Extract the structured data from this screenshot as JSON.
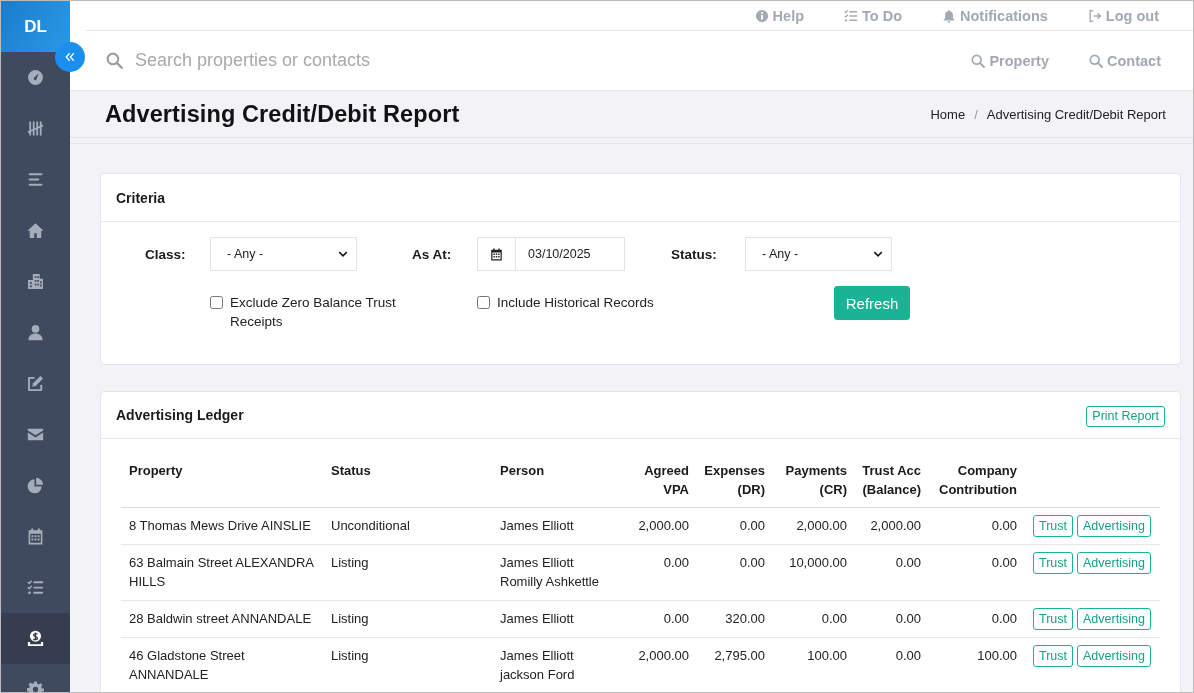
{
  "sidebar": {
    "logo": "DL",
    "items": [
      {
        "selected": false
      },
      {
        "selected": false
      },
      {
        "selected": false
      },
      {
        "selected": false
      },
      {
        "selected": false
      },
      {
        "selected": false
      },
      {
        "selected": false
      },
      {
        "selected": false
      },
      {
        "selected": false
      },
      {
        "selected": false
      },
      {
        "selected": false
      },
      {
        "selected": true
      },
      {
        "selected": false
      }
    ]
  },
  "top_links": [
    "Help",
    "To Do",
    "Notifications",
    "Log out"
  ],
  "search": {
    "placeholder": "Search properties or contacts",
    "links": [
      "Property",
      "Contact"
    ]
  },
  "page_heading": {
    "title": "Advertising Credit/Debit Report",
    "breadcrumb": [
      "Home",
      "Advertising Credit/Debit Report"
    ],
    "breadcrumb_separator": "/"
  },
  "criteria": {
    "title": "Criteria",
    "fields": [
      {
        "kind": "select",
        "label": "Class:",
        "value": "- Any -"
      },
      {
        "kind": "date",
        "label": "As At:",
        "value": "03/10/2025"
      },
      {
        "kind": "select",
        "label": "Status:",
        "value": "- Any -"
      }
    ],
    "checkboxes": [
      {
        "label": "Exclude Zero Balance Trust Receipts",
        "checked": false
      },
      {
        "label": "Include Historical Records",
        "checked": false
      }
    ],
    "button": "Refresh"
  },
  "ledger": {
    "title": "Advertising Ledger",
    "print_button": "Print Report",
    "table": {
      "columns": [
        "Property",
        "Status",
        "Person",
        "Agreed VPA",
        "Expenses (DR)",
        "Payments (CR)",
        "Trust Acc (Balance)",
        "Company Contribution"
      ],
      "rows": [
        {
          "property": "8 Thomas Mews Drive AINSLIE",
          "status": "Unconditional",
          "people": [
            "James Elliott"
          ],
          "agreed_vpa": "2,000.00",
          "expenses": "0.00",
          "payments": "2,000.00",
          "trust_balance": "2,000.00",
          "company_contribution": "0.00",
          "actions": [
            "Trust",
            "Advertising"
          ]
        },
        {
          "property": "63 Balmain Street ALEXANDRA HILLS",
          "status": "Listing",
          "people": [
            "James Elliott",
            "Romilly Ashkettle"
          ],
          "agreed_vpa": "0.00",
          "expenses": "0.00",
          "payments": "10,000.00",
          "trust_balance": "0.00",
          "company_contribution": "0.00",
          "actions": [
            "Trust",
            "Advertising"
          ]
        },
        {
          "property": "28 Baldwin street ANNANDALE",
          "status": "Listing",
          "people": [
            "James Elliott"
          ],
          "agreed_vpa": "0.00",
          "expenses": "320.00",
          "payments": "0.00",
          "trust_balance": "0.00",
          "company_contribution": "0.00",
          "actions": [
            "Trust",
            "Advertising"
          ]
        },
        {
          "property": "46 Gladstone Street ANNANDALE",
          "status": "Listing",
          "people": [
            "James Elliott",
            "jackson Ford"
          ],
          "agreed_vpa": "2,000.00",
          "expenses": "2,795.00",
          "payments": "100.00",
          "trust_balance": "0.00",
          "company_contribution": "100.00",
          "actions": [
            "Trust",
            "Advertising"
          ]
        }
      ]
    }
  }
}
